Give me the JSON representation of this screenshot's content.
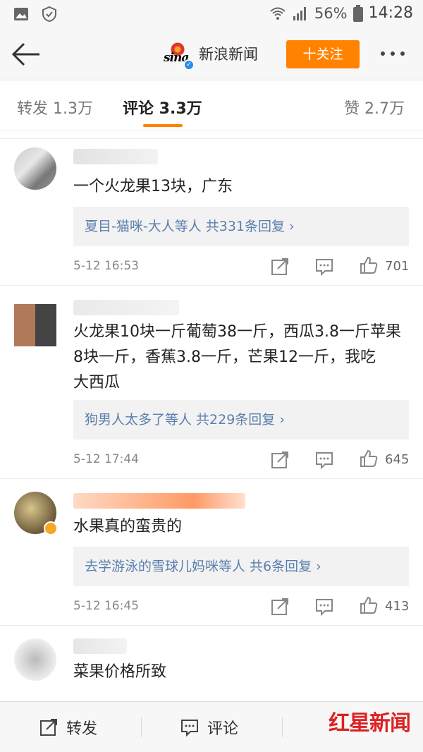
{
  "status_bar": {
    "battery": "56%",
    "time": "14:28"
  },
  "nav": {
    "account_name": "新浪新闻",
    "logo_text": "sina",
    "follow_label": "十关注"
  },
  "tabs": [
    {
      "label": "转发 1.3万"
    },
    {
      "label": "评论 3.3万"
    },
    {
      "label": "赞 2.7万"
    }
  ],
  "comments": [
    {
      "text": "一个火龙果13块，广东",
      "reply": "夏目-猫咪-大人等人  共331条回复 ›",
      "time": "5-12 16:53",
      "likes": "701"
    },
    {
      "text": "火龙果10块一斤葡萄38一斤，西瓜3.8一斤苹果8块一斤，香蕉3.8一斤，芒果12一斤，我吃　　大西瓜",
      "reply": "狗男人太多了等人  共229条回复 ›",
      "time": "5-12 17:44",
      "likes": "645"
    },
    {
      "text": "水果真的蛮贵的",
      "reply": "去学游泳的雪球儿妈咪等人  共6条回复 ›",
      "time": "5-12 16:45",
      "likes": "413"
    },
    {
      "text": "菜果价格所致"
    }
  ],
  "bottom_bar": {
    "repost_label": "转发",
    "comment_label": "评论"
  },
  "watermark": "红星新闻",
  "colors": {
    "accent": "#ff8200",
    "link": "#5b7fae"
  }
}
